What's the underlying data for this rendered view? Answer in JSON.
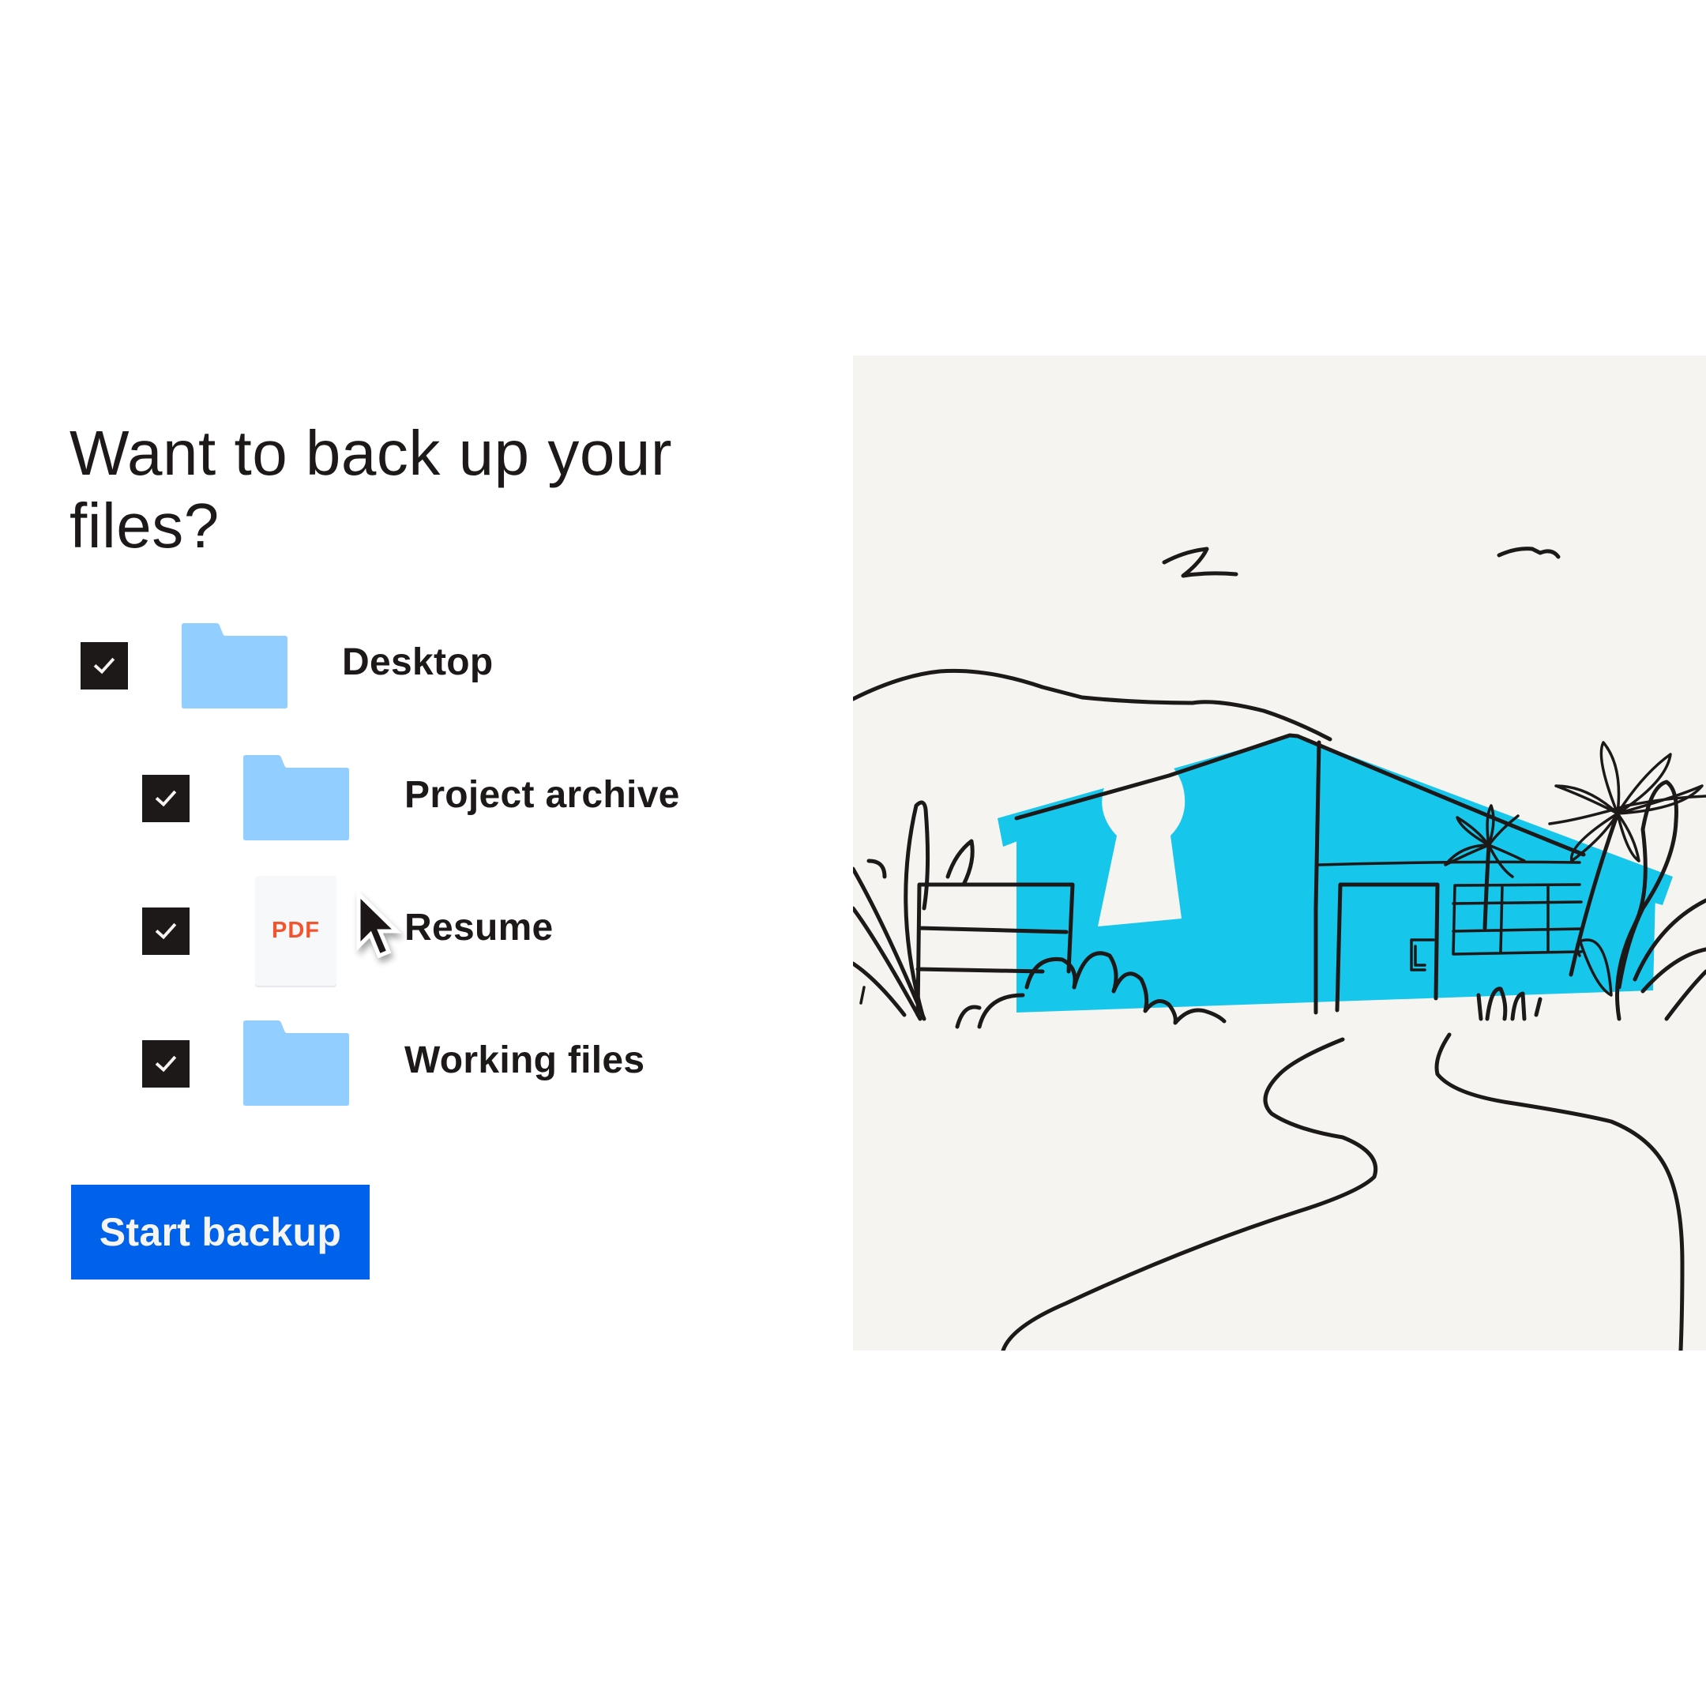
{
  "headline": "Want to back up your files?",
  "items": [
    {
      "label": "Desktop",
      "checked": true,
      "icon": "folder-icon",
      "indent_level": 0
    },
    {
      "label": "Project archive",
      "checked": true,
      "icon": "folder-icon",
      "indent_level": 1
    },
    {
      "label": "Resume",
      "checked": true,
      "icon": "pdf-file-icon",
      "icon_text": "PDF",
      "indent_level": 1
    },
    {
      "label": "Working files",
      "checked": true,
      "icon": "folder-icon",
      "indent_level": 1
    }
  ],
  "cursor": {
    "icon": "mouse-pointer-icon",
    "hovering_item": "Resume"
  },
  "primary_button": {
    "label": "Start backup"
  },
  "illustration": {
    "subject": "house-with-keyhole",
    "description": "Hand-drawn house with blue walls and a keyhole, palm trees, hills, birds and a winding path"
  },
  "colors": {
    "text": "#1e1919",
    "folder": "#92ceff",
    "pdf_accent": "#f2542d",
    "button": "#0061eb",
    "button_text": "#f7f5f2",
    "illustration_bg": "#f5f4f1",
    "house": "#17c6eb",
    "checkbox": "#1e1919"
  }
}
